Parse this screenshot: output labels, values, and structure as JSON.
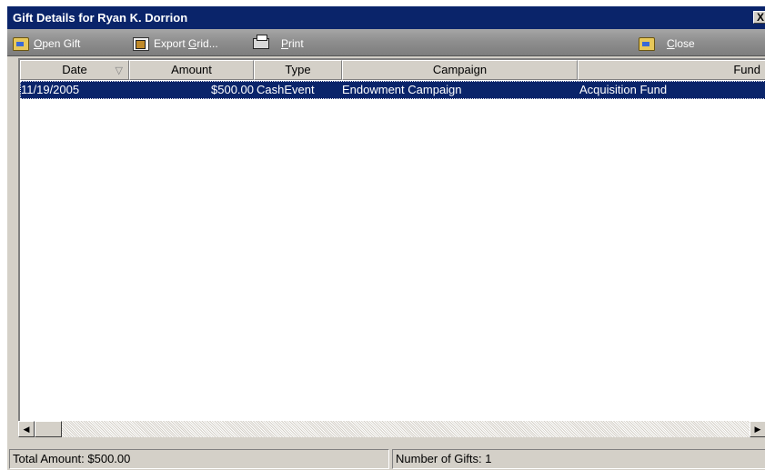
{
  "window": {
    "title": "Gift Details for Ryan K. Dorrion",
    "close_label": "X"
  },
  "toolbar": {
    "open_gift": {
      "prefix": "",
      "accel": "O",
      "rest": "pen Gift",
      "icon": "open-folder-icon"
    },
    "export_grid": {
      "prefix": "Export ",
      "accel": "G",
      "rest": "rid...",
      "icon": "export-icon"
    },
    "print": {
      "prefix": "",
      "accel": "P",
      "rest": "rint",
      "icon": "printer-icon"
    },
    "close": {
      "prefix": "",
      "accel": "C",
      "rest": "lose",
      "icon": "close-folder-icon"
    }
  },
  "grid": {
    "columns": [
      "Date",
      "Amount",
      "Type",
      "Campaign",
      "Fund"
    ],
    "sort_indicator": "▽",
    "rows": [
      {
        "date": "11/19/2005",
        "amount": "$500.00",
        "type": "CashEvent",
        "campaign": "Endowment Campaign",
        "fund": "Acquisition Fund"
      }
    ]
  },
  "status": {
    "total_amount": "Total Amount: $500.00",
    "number_of_gifts": "Number of Gifts: 1"
  },
  "colors": {
    "titlebar": "#0a246a",
    "selection": "#0a246a",
    "face": "#d4d0c8"
  }
}
